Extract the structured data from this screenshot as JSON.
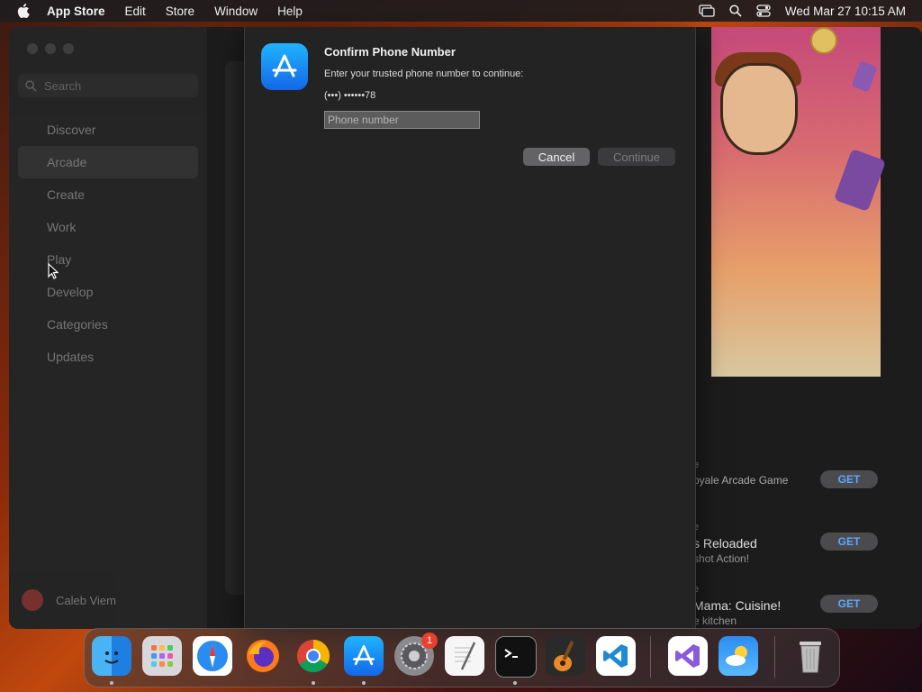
{
  "menubar": {
    "app_name": "App Store",
    "items": [
      "Edit",
      "Store",
      "Window",
      "Help"
    ],
    "clock": "Wed Mar 27  10:15 AM"
  },
  "sidebar": {
    "search_placeholder": "Search",
    "items": [
      {
        "label": "Discover"
      },
      {
        "label": "Arcade"
      },
      {
        "label": "Create"
      },
      {
        "label": "Work"
      },
      {
        "label": "Play"
      },
      {
        "label": "Develop"
      },
      {
        "label": "Categories"
      },
      {
        "label": "Updates"
      }
    ],
    "active": "Arcade",
    "user_name": "Caleb Viem"
  },
  "games": [
    {
      "sub": "e",
      "line1": "oyale Arcade Game",
      "line2": "",
      "get": "GET"
    },
    {
      "sub": "e",
      "line1": "s Reloaded",
      "line2": "shot Action!",
      "get": "GET"
    },
    {
      "sub": "e",
      "line1": "Mama: Cuisine!",
      "line2": "e kitchen",
      "get": "GET"
    }
  ],
  "dialog": {
    "title": "Confirm Phone Number",
    "message": "Enter your trusted phone number to continue:",
    "masked_number": "(•••) ••••••78",
    "input_placeholder": "Phone number",
    "input_value": "",
    "cancel_label": "Cancel",
    "continue_label": "Continue"
  },
  "dock": {
    "apps": [
      "finder-icon",
      "launchpad-icon",
      "safari-icon",
      "firefox-icon",
      "chrome-icon",
      "app-store-icon",
      "system-settings-icon",
      "textedit-icon",
      "terminal-icon",
      "garageband-icon",
      "vscode-icon",
      "visual-studio-icon",
      "weather-icon",
      "trash-icon"
    ],
    "settings_badge": "1"
  },
  "colors": {
    "accent_blue": "#1e88f5",
    "get_text": "#5fa8ff",
    "badge_red": "#e8412f"
  }
}
